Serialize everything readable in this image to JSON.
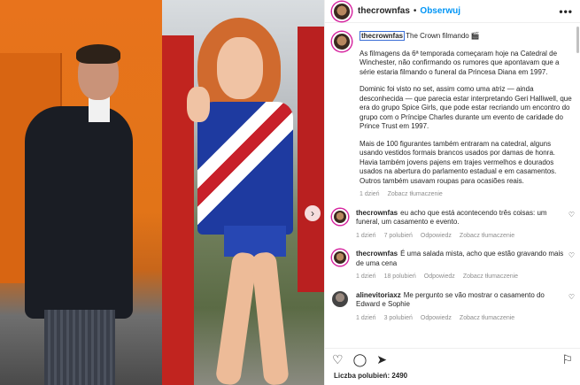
{
  "header": {
    "username": "thecrownfas",
    "separator": "•",
    "follow_label": "Obserwuj",
    "more_label": "•••"
  },
  "caption": {
    "username": "thecrownfas",
    "title": "The Crown filmando 🎬",
    "paragraphs": [
      "As filmagens da 6ª temporada começaram hoje na Catedral de Winchester, não confirmando os rumores que apontavam que a série estaria filmando o funeral da Princesa Diana em 1997.",
      "Dominic foi visto no set, assim como uma atriz — ainda desconhecida — que parecia estar interpretando Geri Halliwell, que era do grupo Spice Girls, que pode estar recriando um encontro do grupo com o Príncipe Charles durante um evento de caridade do Prince Trust em 1997.",
      "Mais de 100 figurantes também entraram na catedral, alguns usando vestidos formais brancos usados por damas de honra. Havia também jovens pajens em trajes vermelhos e dourados usados na abertura do parlamento estadual e em casamentos. Outros também usavam roupas para ocasiões reais."
    ],
    "time": "1 dzień",
    "translate": "Zobacz tłumaczenie"
  },
  "comments": [
    {
      "username": "thecrownfas",
      "text": "eu acho que está acontecendo três coisas: um funeral, um casamento e evento.",
      "time": "1 dzień",
      "likes": "7 polubień",
      "reply": "Odpowiedz",
      "translate": "Zobacz tłumaczenie",
      "avatar": "crown"
    },
    {
      "username": "thecrownfas",
      "text": "É uma salada mista, acho que estão gravando mais de uma cena",
      "time": "1 dzień",
      "likes": "18 polubień",
      "reply": "Odpowiedz",
      "translate": "Zobacz tłumaczenie",
      "avatar": "crown"
    },
    {
      "username": "alinevitoriaxz",
      "text": "Me pergunto se vão mostrar o casamento do Edward e Sophie",
      "time": "1 dzień",
      "likes": "3 polubień",
      "reply": "Odpowiedz",
      "translate": "Zobacz tłumaczenie",
      "avatar": "grey"
    }
  ],
  "actions": {
    "like_icon": "♡",
    "comment_icon": "◯",
    "share_icon": "➤",
    "save_icon": "⚐"
  },
  "likes_label": "Liczba polubień: 2490",
  "carousel": {
    "next_icon": "›"
  }
}
